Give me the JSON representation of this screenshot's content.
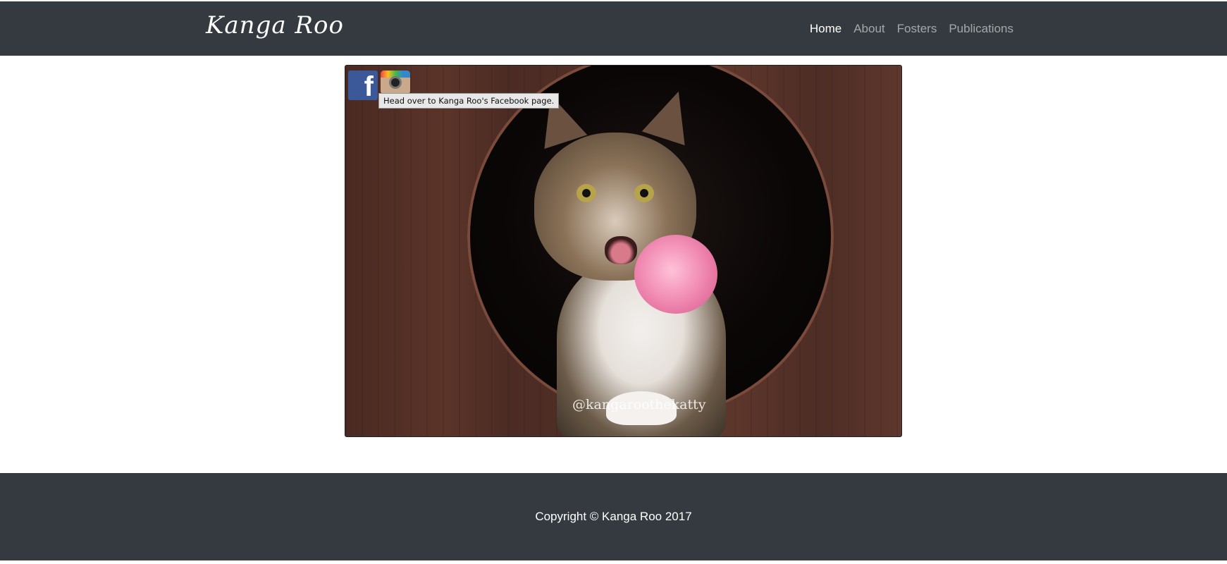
{
  "navbar": {
    "brand": "Kanga Roo",
    "items": [
      {
        "label": "Home",
        "active": true
      },
      {
        "label": "About",
        "active": false
      },
      {
        "label": "Fosters",
        "active": false
      },
      {
        "label": "Publications",
        "active": false
      }
    ]
  },
  "hero": {
    "watermark": "@kangaroothekatty",
    "social": {
      "facebook_icon": "facebook-icon",
      "instagram_icon": "instagram-icon",
      "tooltip": "Head over to Kanga Roo's Facebook page."
    }
  },
  "footer": {
    "copyright": "Copyright © Kanga Roo 2017"
  },
  "colors": {
    "navbar_bg": "#343a40",
    "footer_bg": "#343a40",
    "nav_active": "#ffffff",
    "nav_inactive": "#9a9da0",
    "facebook_blue": "#3b5998"
  }
}
